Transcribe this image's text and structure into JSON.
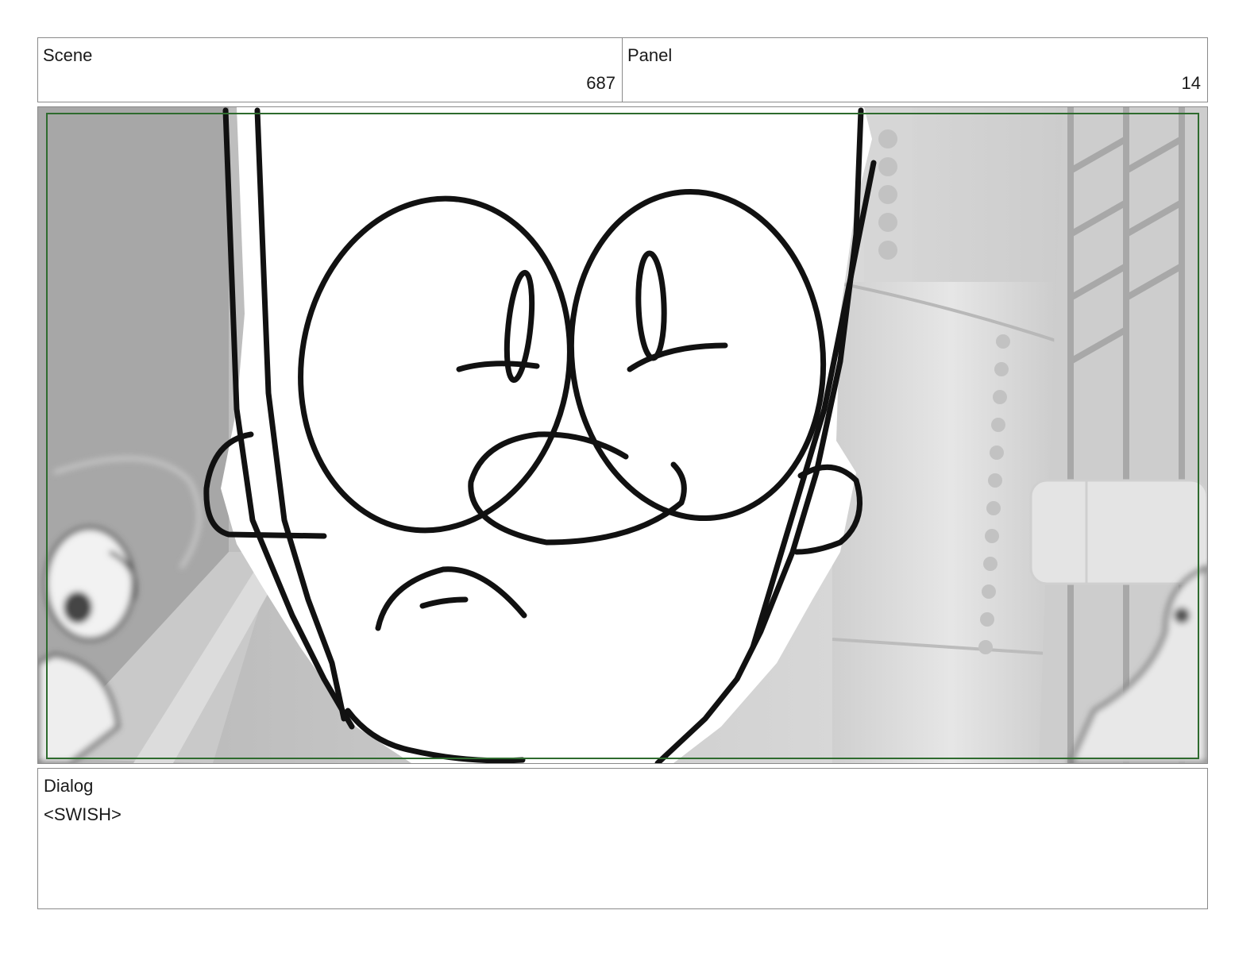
{
  "header": {
    "scene_label": "Scene",
    "scene_value": "687",
    "panel_label": "Panel",
    "panel_value": "14"
  },
  "frame": {
    "image_subject": "storyboard sketch of a character face with large glasses in front of a gray industrial background",
    "safe_area_color": "#2e6b2e"
  },
  "dialog": {
    "label": "Dialog",
    "text": "<SWISH>"
  }
}
